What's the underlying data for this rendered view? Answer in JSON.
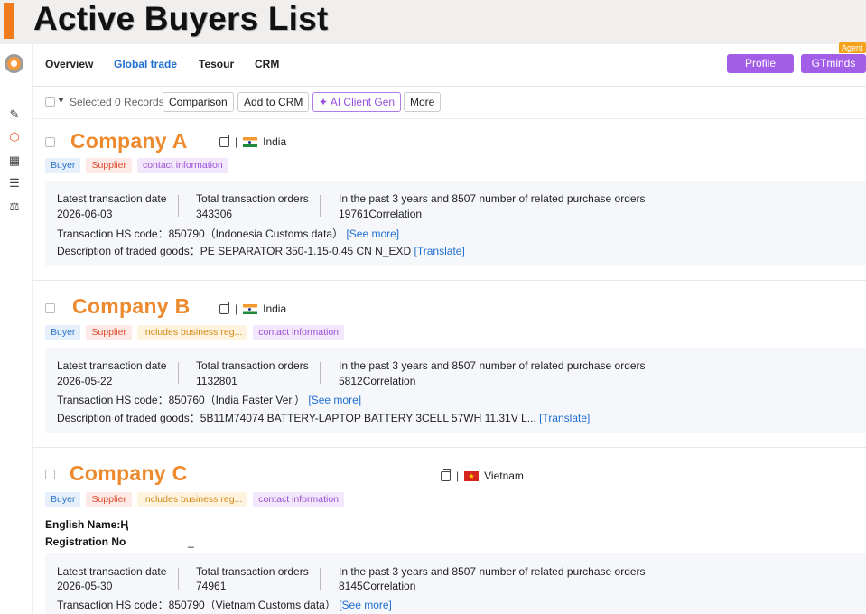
{
  "banner": {
    "title": "Active Buyers List"
  },
  "nav": {
    "items": [
      "Overview",
      "Global trade",
      "Tesour",
      "CRM"
    ],
    "profile": "Profile",
    "gtminds": "GTminds",
    "agent": "Agent"
  },
  "toolbar": {
    "selected": "Selected 0 Records",
    "comparison": "Comparison",
    "add_crm": "Add to CRM",
    "ai_client": "AI Client Gen",
    "more": "More"
  },
  "labels": {
    "latest_date": "Latest transaction date",
    "total_orders": "Total transaction orders",
    "past_3y": "In the past 3 years and 8507 number of related purchase orders",
    "hs_code": "Transaction HS code：",
    "desc": "Description of traded goods：",
    "see_more": "[See more]",
    "translate": "[Translate]",
    "english_name": "English Name:Ң",
    "registration_no": "Registration No",
    "registration_mark": "_"
  },
  "companies": [
    {
      "name": "Company A",
      "country": "India",
      "tags": [
        "Buyer",
        "Supplier",
        "contact information"
      ],
      "latest_date": "2026-06-03",
      "total_orders": "343306",
      "correlation": "19761Correlation",
      "hs": "850790（Indonesia Customs data）",
      "desc": "PE SEPARATOR 350-1.15-0.45 CN N_EXD"
    },
    {
      "name": "Company B",
      "country": "India",
      "tags": [
        "Buyer",
        "Supplier",
        "Includes business reg...",
        "contact information"
      ],
      "latest_date": "2026-05-22",
      "total_orders": "1132801",
      "correlation": "5812Correlation",
      "hs": "850760（India Faster Ver.）",
      "desc": "5B11M74074 BATTERY-LAPTOP BATTERY 3CELL 57WH 11.31V L..."
    },
    {
      "name": "Company C",
      "country": "Vietnam",
      "tags": [
        "Buyer",
        "Supplier",
        "Includes business reg...",
        "contact information"
      ],
      "latest_date": "2026-05-30",
      "total_orders": "74961",
      "correlation": "8145Correlation",
      "hs": "850790（Vietnam Customs data）"
    }
  ]
}
